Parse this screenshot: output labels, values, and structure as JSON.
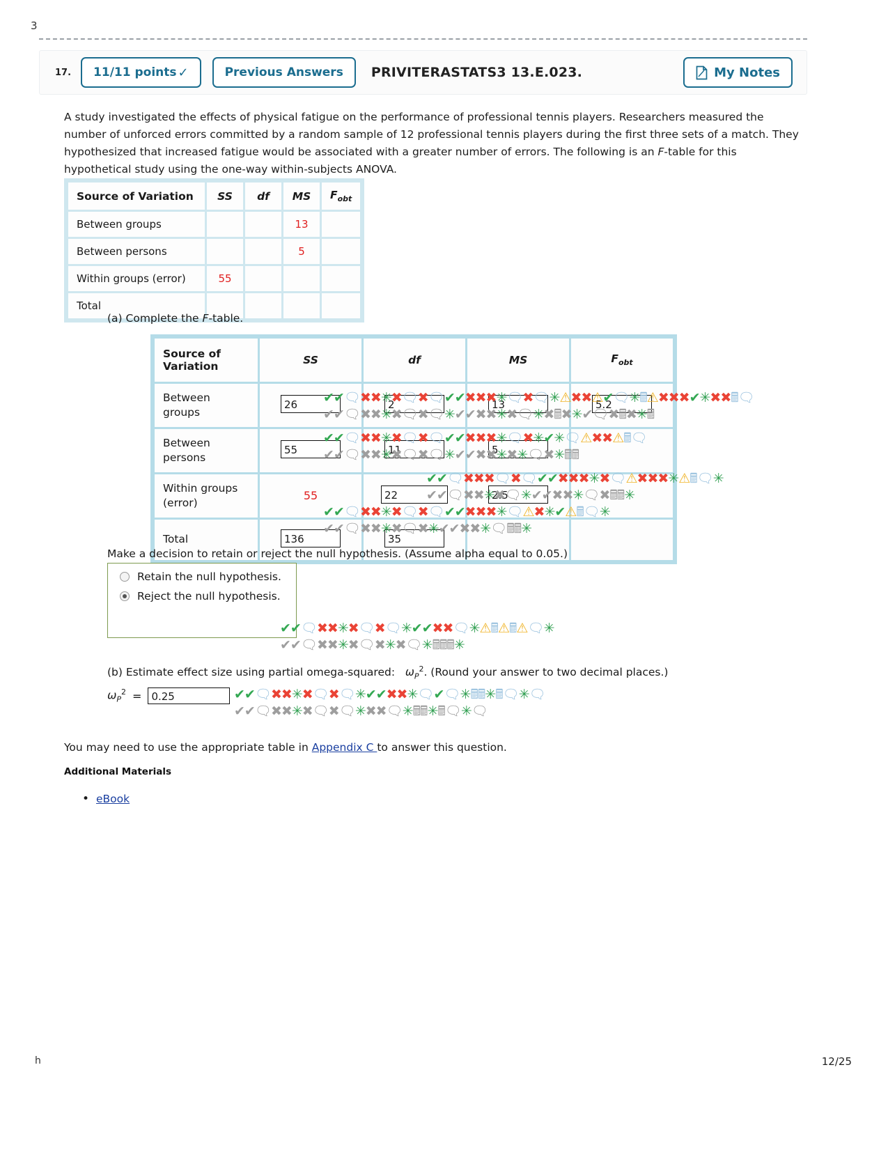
{
  "page": {
    "top_mark": "3",
    "footer_left": "h",
    "footer_right": "12/25"
  },
  "header": {
    "number": "17.",
    "points_label": "11/11 points",
    "points_check": "✓",
    "previous_answers_label": "Previous Answers",
    "question_code": "PRIVITERASTATS3 13.E.023.",
    "my_notes_label": "My Notes",
    "notes_icon": "note-page-icon"
  },
  "prompt": {
    "p1": "A study investigated the effects of physical fatigue on the performance of professional tennis players. Researchers measured the number of unforced errors committed by a random sample of 12 professional tennis players during the first three sets of a match. They hypothesized that increased fatigue would be associated with a greater number of errors. The following is an ",
    "p1_italic": "F",
    "p2": "-table for this hypothetical study using the one-way within-subjects ANOVA."
  },
  "given_table": {
    "headers": [
      "Source of Variation",
      "SS",
      "df",
      "MS",
      "F"
    ],
    "fobt_sub": "obt",
    "rows": [
      {
        "source": "Between groups",
        "ss": "",
        "df": "",
        "ms": "13",
        "fobt": ""
      },
      {
        "source": "Between persons",
        "ss": "",
        "df": "",
        "ms": "5",
        "fobt": ""
      },
      {
        "source": "Within groups (error)",
        "ss": "55",
        "df": "",
        "ms": "",
        "fobt": ""
      },
      {
        "source": "Total",
        "ss": "",
        "df": "",
        "ms": "",
        "fobt": ""
      }
    ]
  },
  "part_a": {
    "label": "(a) Complete the ",
    "label_italic": "F",
    "label_tail": "-table.",
    "headers": [
      "Source of Variation",
      "SS",
      "df",
      "MS",
      "F"
    ],
    "fobt_sub": "obt",
    "rows": [
      {
        "source": "Between groups",
        "ss": "26",
        "ss_given": false,
        "df": "2",
        "df_given": false,
        "ms": "13",
        "ms_given": false,
        "fobt": "5.2",
        "fobt_given": false
      },
      {
        "source": "Between persons",
        "ss": "55",
        "ss_given": false,
        "df": "11",
        "df_given": false,
        "ms": "5",
        "ms_given": false,
        "fobt": "",
        "fobt_given": false
      },
      {
        "source": "Within groups (error)",
        "ss": "55",
        "ss_given": true,
        "df": "22",
        "df_given": false,
        "ms": "2.5",
        "ms_given": false,
        "fobt": "",
        "fobt_given": false
      },
      {
        "source": "Total",
        "ss": "136",
        "ss_given": false,
        "df": "35",
        "df_given": false,
        "ms": "",
        "ms_given": false,
        "fobt": "",
        "fobt_given": false
      }
    ]
  },
  "decision": {
    "question": "Make a decision to retain or reject the null hypothesis. (Assume alpha equal to 0.05.)",
    "options": [
      {
        "label": "Retain the null hypothesis.",
        "selected": false
      },
      {
        "label": "Reject the null hypothesis.",
        "selected": true
      }
    ]
  },
  "part_b": {
    "text_before": "(b) Estimate effect size using partial omega-squared:",
    "symbol": "ω",
    "symbol_sub": "P",
    "symbol_sup": "2",
    "text_after": ". (Round your answer to two decimal places.)",
    "equals": "=",
    "answer": "0.25"
  },
  "footer_content": {
    "appendix_before": "You may need to use the appropriate table in ",
    "appendix_link": "Appendix C ",
    "appendix_after": "to answer this question.",
    "additional_materials": "Additional Materials",
    "ebook_link": "eBook"
  },
  "colors": {
    "accent": "#1b6d8f",
    "given_value": "#e02020",
    "table_border": "#b5dce8",
    "link": "#1a3fa0",
    "correct": "#34a853",
    "incorrect": "#ea4335"
  }
}
